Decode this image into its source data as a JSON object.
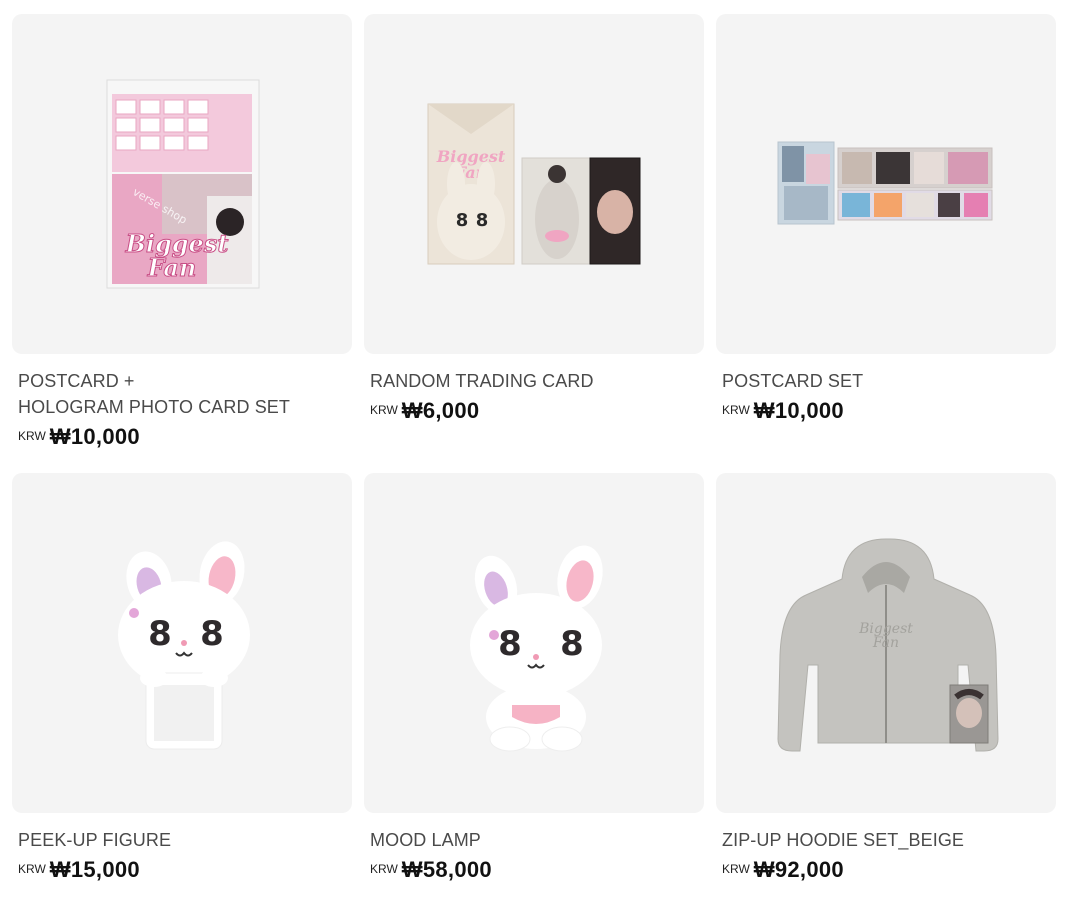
{
  "products": [
    {
      "name_lines": [
        "POSTCARD +",
        "HOLOGRAM PHOTO CARD SET"
      ],
      "currency": "KRW",
      "price": "₩10,000",
      "image": "postcard-hologram-set-image"
    },
    {
      "name_lines": [
        "RANDOM TRADING CARD"
      ],
      "currency": "KRW",
      "price": "₩6,000",
      "image": "trading-card-image"
    },
    {
      "name_lines": [
        "POSTCARD SET"
      ],
      "currency": "KRW",
      "price": "₩10,000",
      "image": "postcard-set-image"
    },
    {
      "name_lines": [
        "PEEK-UP FIGURE"
      ],
      "currency": "KRW",
      "price": "₩15,000",
      "image": "peek-up-figure-image"
    },
    {
      "name_lines": [
        "MOOD LAMP"
      ],
      "currency": "KRW",
      "price": "₩58,000",
      "image": "mood-lamp-image"
    },
    {
      "name_lines": [
        "ZIP-UP HOODIE SET_BEIGE"
      ],
      "currency": "KRW",
      "price": "₩92,000",
      "image": "zip-up-hoodie-image"
    }
  ],
  "theme": {
    "card_bg": "#f4f4f4",
    "text": "#4a4a4a",
    "price": "#111111",
    "accent_pink": "#e79ab7"
  },
  "image_text": {
    "logo": "Biggest Fan",
    "watermark": "verse shop"
  }
}
